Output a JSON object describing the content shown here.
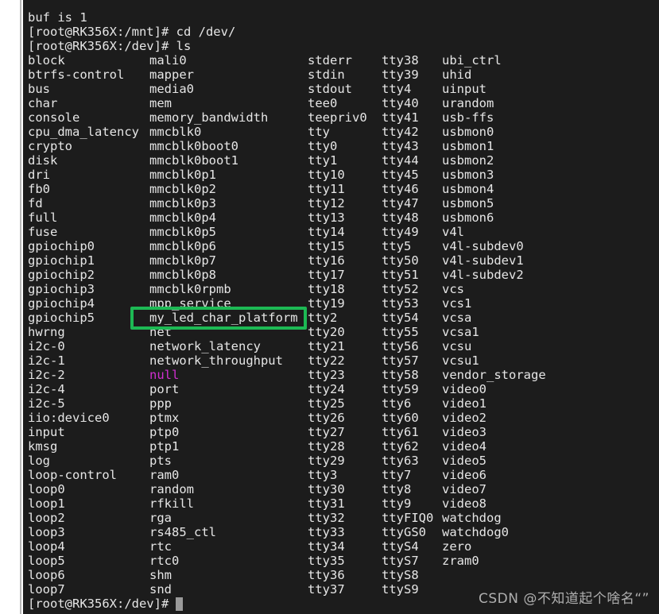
{
  "terminal": {
    "background_color": "#1c1c1c",
    "foreground_color": "#e6e6e6",
    "magenta_color": "#d02fd0",
    "highlight_color": "#1db954",
    "preamble": [
      "buf is 1",
      "[root@RK356X:/mnt]# cd /dev/",
      "[root@RK356X:/dev]# ls"
    ],
    "line_0": "buf is 1",
    "line_1": "[root@RK356X:/mnt]# cd /dev/",
    "line_2": "[root@RK356X:/dev]# ls",
    "prompt_final": "[root@RK356X:/dev]# ",
    "columns": {
      "col1": [
        "block",
        "btrfs-control",
        "bus",
        "char",
        "console",
        "cpu_dma_latency",
        "crypto",
        "disk",
        "dri",
        "fb0",
        "fd",
        "full",
        "fuse",
        "gpiochip0",
        "gpiochip1",
        "gpiochip2",
        "gpiochip3",
        "gpiochip4",
        "gpiochip5",
        "hwrng",
        "i2c-0",
        "i2c-1",
        "i2c-2",
        "i2c-4",
        "i2c-5",
        "iio:device0",
        "input",
        "kmsg",
        "log",
        "loop-control",
        "loop0",
        "loop1",
        "loop2",
        "loop3",
        "loop4",
        "loop5",
        "loop6",
        "loop7"
      ],
      "col2": [
        "mali0",
        "mapper",
        "media0",
        "mem",
        "memory_bandwidth",
        "mmcblk0",
        "mmcblk0boot0",
        "mmcblk0boot1",
        "mmcblk0p1",
        "mmcblk0p2",
        "mmcblk0p3",
        "mmcblk0p4",
        "mmcblk0p5",
        "mmcblk0p6",
        "mmcblk0p7",
        "mmcblk0p8",
        "mmcblk0rpmb",
        "mpp_service",
        "my_led_char_platform",
        "net",
        "network_latency",
        "network_throughput",
        "null",
        "port",
        "ppp",
        "ptmx",
        "ptp0",
        "ptp1",
        "pts",
        "ram0",
        "random",
        "rfkill",
        "rga",
        "rs485_ctl",
        "rtc",
        "rtc0",
        "shm",
        "snd"
      ],
      "col3": [
        "stderr",
        "stdin",
        "stdout",
        "tee0",
        "teepriv0",
        "tty",
        "tty0",
        "tty1",
        "tty10",
        "tty11",
        "tty12",
        "tty13",
        "tty14",
        "tty15",
        "tty16",
        "tty17",
        "tty18",
        "tty19",
        "tty2",
        "tty20",
        "tty21",
        "tty22",
        "tty23",
        "tty24",
        "tty25",
        "tty26",
        "tty27",
        "tty28",
        "tty29",
        "tty3",
        "tty30",
        "tty31",
        "tty32",
        "tty33",
        "tty34",
        "tty35",
        "tty36",
        "tty37"
      ],
      "col4": [
        "tty38",
        "tty39",
        "tty4",
        "tty40",
        "tty41",
        "tty42",
        "tty43",
        "tty44",
        "tty45",
        "tty46",
        "tty47",
        "tty48",
        "tty49",
        "tty5",
        "tty50",
        "tty51",
        "tty52",
        "tty53",
        "tty54",
        "tty55",
        "tty56",
        "tty57",
        "tty58",
        "tty59",
        "tty6",
        "tty60",
        "tty61",
        "tty62",
        "tty63",
        "tty7",
        "tty8",
        "tty9",
        "ttyFIQ0",
        "ttyGS0",
        "ttyS4",
        "ttyS7",
        "ttyS8",
        "ttyS9"
      ],
      "col5": [
        "ubi_ctrl",
        "uhid",
        "uinput",
        "urandom",
        "usb-ffs",
        "usbmon0",
        "usbmon1",
        "usbmon2",
        "usbmon3",
        "usbmon4",
        "usbmon5",
        "usbmon6",
        "v4l",
        "v4l-subdev0",
        "v4l-subdev1",
        "v4l-subdev2",
        "vcs",
        "vcs1",
        "vcsa",
        "vcsa1",
        "vcsu",
        "vcsu1",
        "vendor_storage",
        "video0",
        "video1",
        "video2",
        "video3",
        "video4",
        "video5",
        "video6",
        "video7",
        "video8",
        "watchdog",
        "watchdog0",
        "zero",
        "zram0"
      ]
    },
    "magenta_entries": [
      "null"
    ],
    "highlighted_entry": "my_led_char_platform"
  },
  "watermark": {
    "text": "CSDN @不知道起个啥名“”"
  }
}
